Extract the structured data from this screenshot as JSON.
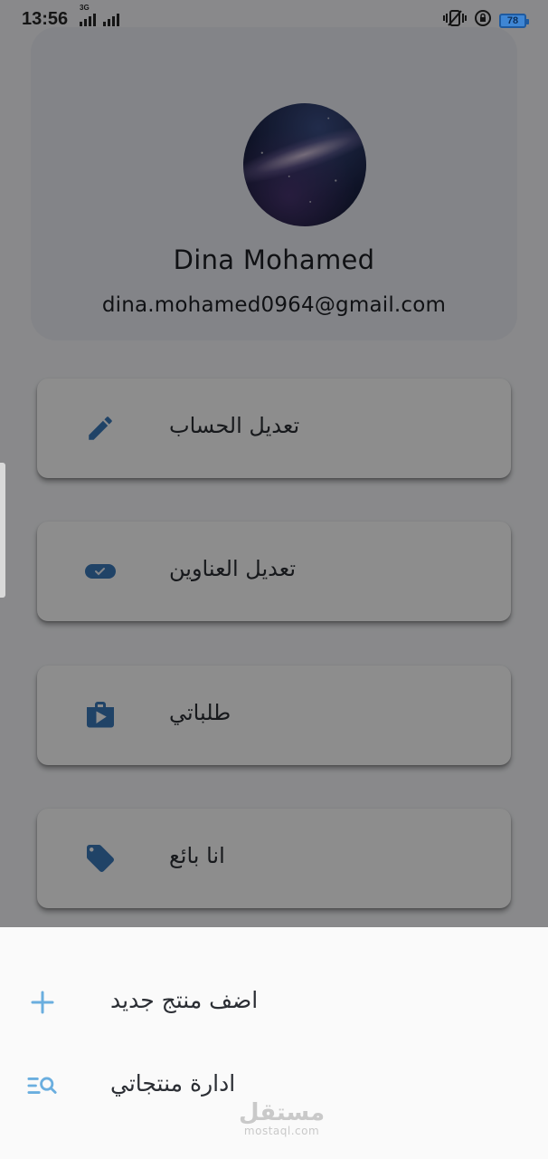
{
  "status_bar": {
    "time": "13:56",
    "network_type": "3G",
    "battery_level": "78",
    "icons": [
      "signal-icon",
      "signal-icon",
      "vibrate-icon",
      "rotation-lock-icon",
      "battery-icon"
    ]
  },
  "profile": {
    "name": "Dina Mohamed",
    "email": "dina.mohamed0964@gmail.com",
    "avatar": "galaxy-avatar"
  },
  "menu": {
    "items": [
      {
        "label": "تعديل الحساب",
        "icon": "pencil-icon"
      },
      {
        "label": "تعديل العناوين",
        "icon": "tag-label-icon"
      },
      {
        "label": "طلباتي",
        "icon": "shop-bag-icon"
      },
      {
        "label": "انا بائع",
        "icon": "price-tag-icon"
      }
    ]
  },
  "bottom_sheet": {
    "items": [
      {
        "label": "اضف منتج جديد",
        "icon": "plus-icon"
      },
      {
        "label": "ادارة منتجاتي",
        "icon": "manage-search-icon"
      }
    ]
  },
  "watermark": {
    "arabic": "مستقل",
    "latin": "mostaql.com"
  },
  "colors": {
    "accent": "#3a78b8",
    "sheet_icon": "#6aaedf",
    "scrim": "rgba(0,0,0,0.44)"
  }
}
